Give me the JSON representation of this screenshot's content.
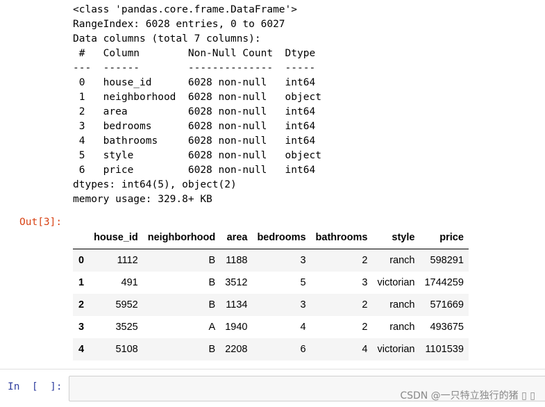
{
  "stdout": {
    "lines": [
      "<class 'pandas.core.frame.DataFrame'>",
      "RangeIndex: 6028 entries, 0 to 6027",
      "Data columns (total 7 columns):",
      " #   Column        Non-Null Count  Dtype ",
      "---  ------        --------------  ----- ",
      " 0   house_id      6028 non-null   int64 ",
      " 1   neighborhood  6028 non-null   object",
      " 2   area          6028 non-null   int64 ",
      " 3   bedrooms      6028 non-null   int64 ",
      " 4   bathrooms     6028 non-null   int64 ",
      " 5   style         6028 non-null   object",
      " 6   price         6028 non-null   int64 ",
      "dtypes: int64(5), object(2)",
      "memory usage: 329.8+ KB"
    ]
  },
  "output": {
    "prompt": "Out[3]:",
    "columns": [
      "",
      "house_id",
      "neighborhood",
      "area",
      "bedrooms",
      "bathrooms",
      "style",
      "price"
    ],
    "rows": [
      [
        "0",
        "1112",
        "B",
        "1188",
        "3",
        "2",
        "ranch",
        "598291"
      ],
      [
        "1",
        "491",
        "B",
        "3512",
        "5",
        "3",
        "victorian",
        "1744259"
      ],
      [
        "2",
        "5952",
        "B",
        "1134",
        "3",
        "2",
        "ranch",
        "571669"
      ],
      [
        "3",
        "3525",
        "A",
        "1940",
        "4",
        "2",
        "ranch",
        "493675"
      ],
      [
        "4",
        "5108",
        "B",
        "2208",
        "6",
        "4",
        "victorian",
        "1101539"
      ]
    ]
  },
  "input": {
    "prompt": "In  [  ]:",
    "value": ""
  },
  "watermark": "CSDN @一只特立独行的猪 ▯ ▯"
}
